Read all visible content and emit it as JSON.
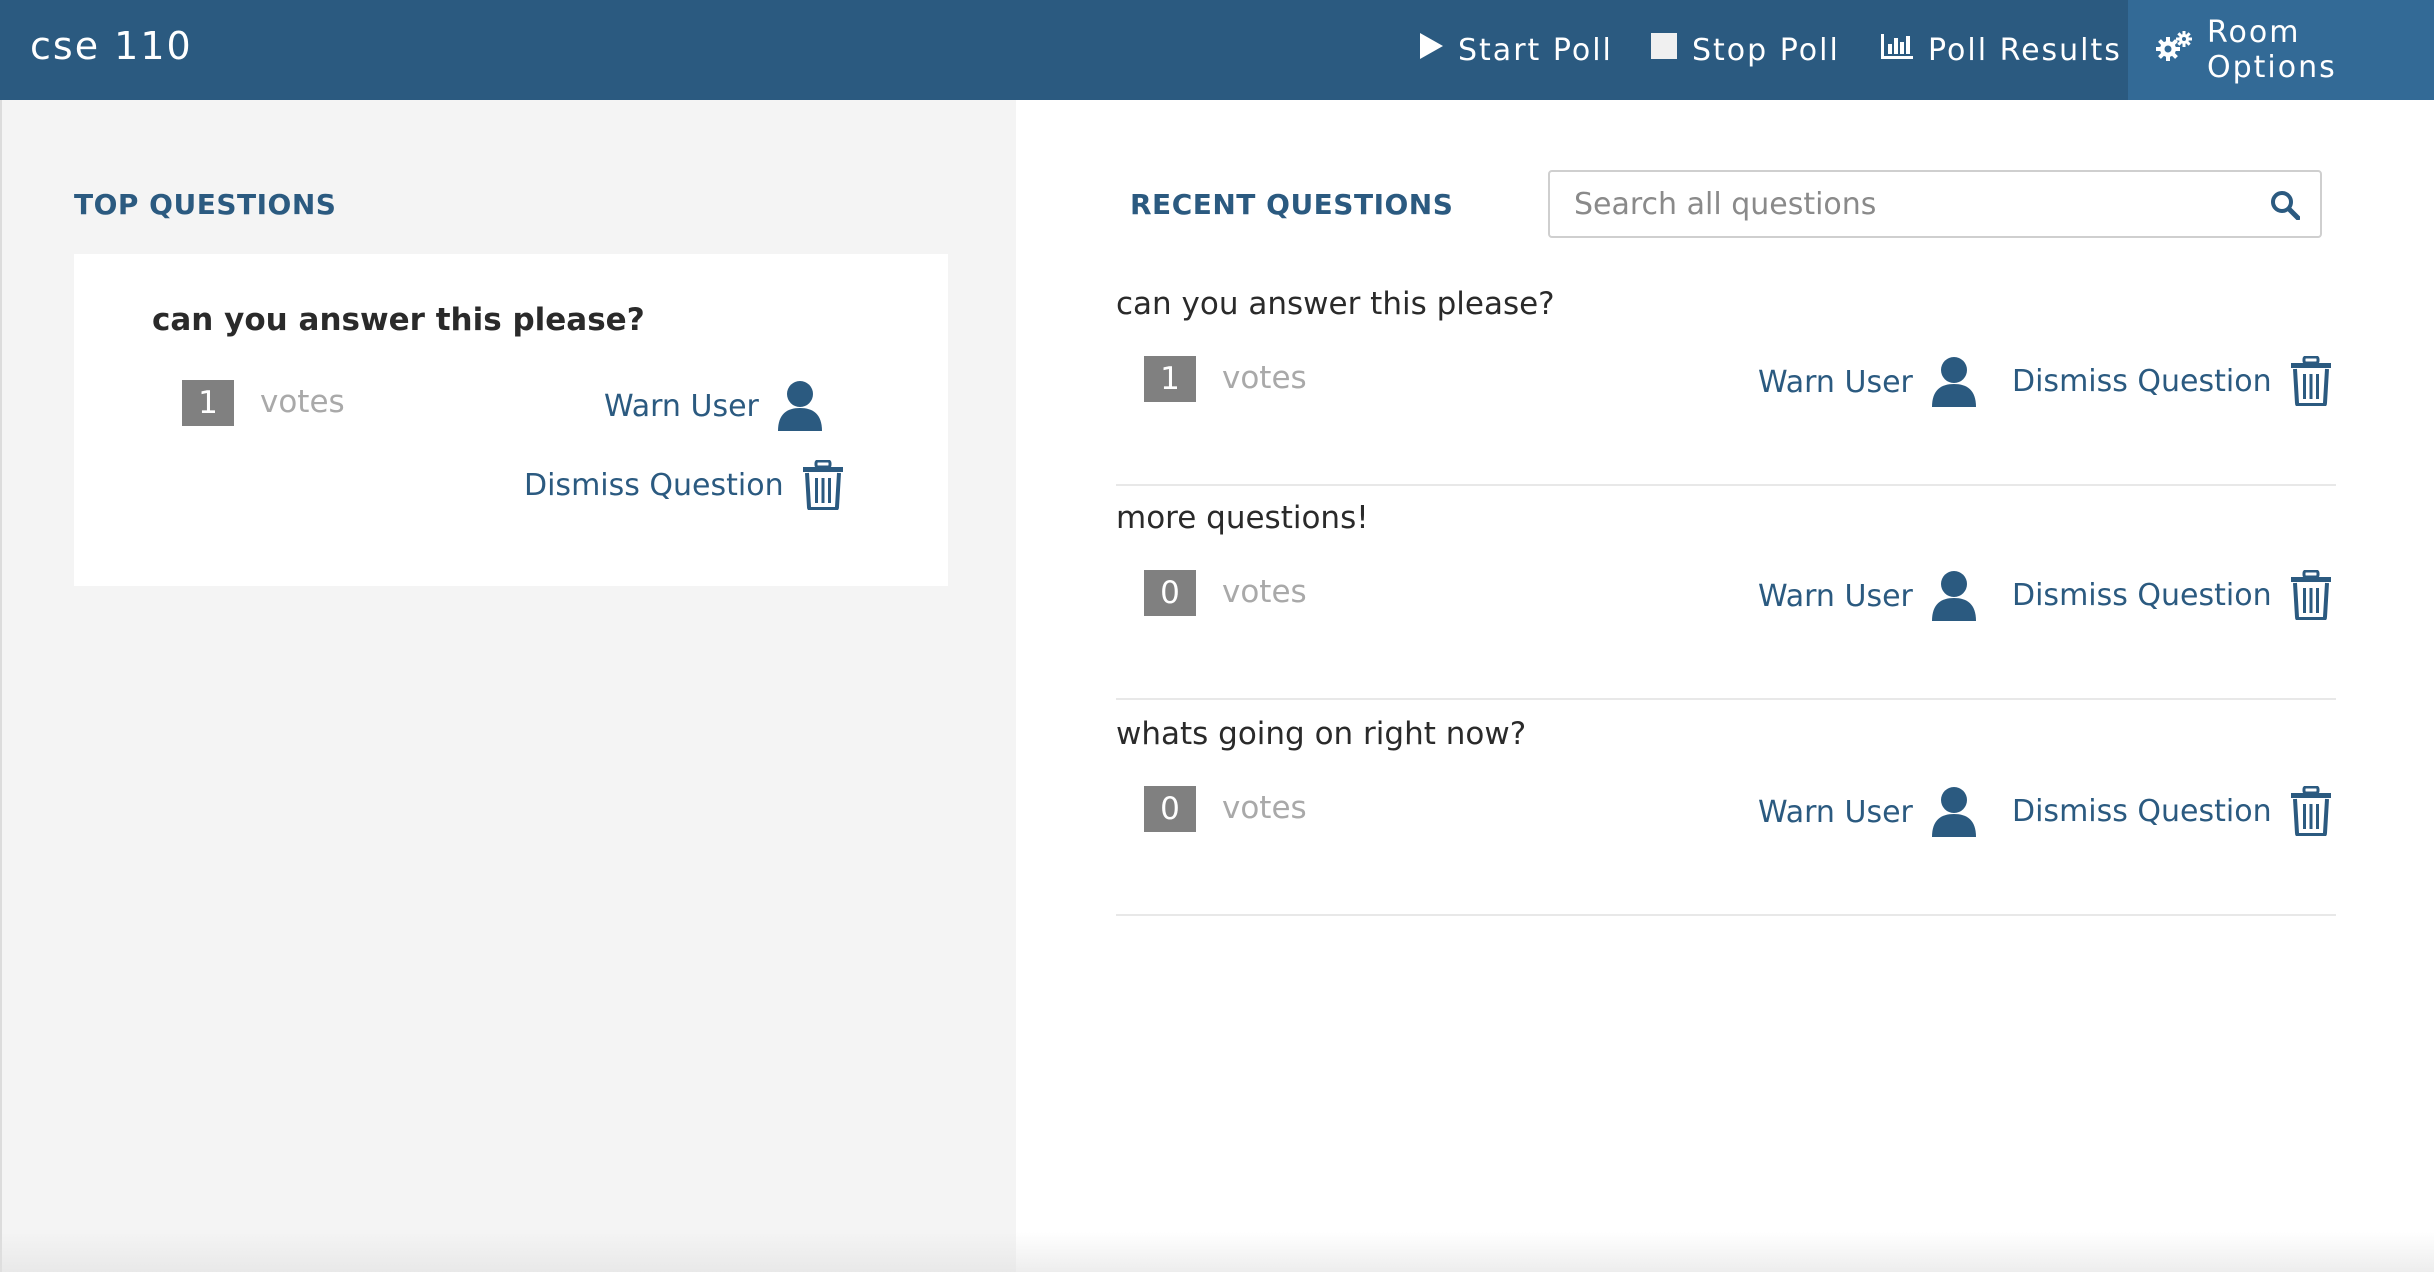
{
  "navbar": {
    "brand": "cse 110",
    "start_poll": "Start Poll",
    "stop_poll": "Stop Poll",
    "poll_results": "Poll Results",
    "room_options": "Room Options",
    "bg_color": "#2b5a80",
    "active_color": "#336a96"
  },
  "top_questions": {
    "title": "TOP QUESTIONS",
    "items": [
      {
        "text": "can you answer this please?",
        "votes": "1",
        "votes_label": "votes",
        "warn_label": "Warn User",
        "dismiss_label": "Dismiss Question"
      }
    ]
  },
  "recent_questions": {
    "title": "RECENT QUESTIONS",
    "search_placeholder": "Search all questions",
    "items": [
      {
        "text": "can you answer this please?",
        "votes": "1",
        "votes_label": "votes",
        "warn_label": "Warn User",
        "dismiss_label": "Dismiss Question"
      },
      {
        "text": "more questions!",
        "votes": "0",
        "votes_label": "votes",
        "warn_label": "Warn User",
        "dismiss_label": "Dismiss Question"
      },
      {
        "text": "whats going on right now?",
        "votes": "0",
        "votes_label": "votes",
        "warn_label": "Warn User",
        "dismiss_label": "Dismiss Question"
      }
    ]
  },
  "icons": [
    "play-icon",
    "stop-icon",
    "bar-chart-icon",
    "gears-icon",
    "search-icon",
    "user-icon",
    "trash-icon"
  ],
  "colors": {
    "accent": "#2b5a80",
    "vote_box": "#808080",
    "muted_text": "#a9a9a9"
  }
}
